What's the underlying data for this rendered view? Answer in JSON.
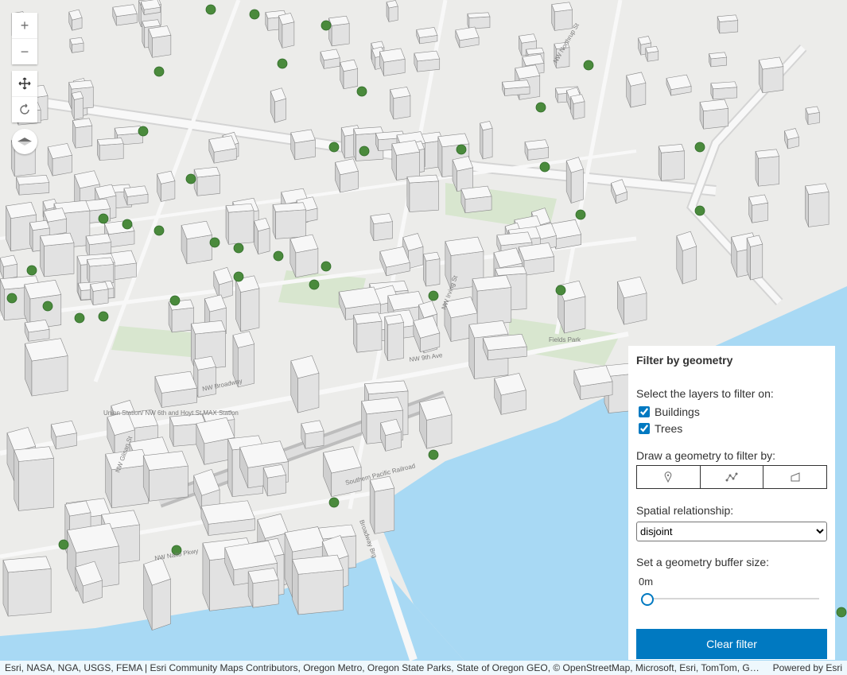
{
  "map": {
    "colors": {
      "water": "#a8d9f4",
      "ground": "#ececea",
      "park": "#d8e6cf",
      "road": "#f8f8f8",
      "building": "#f4f4f4",
      "tree": "#4a8a3c"
    },
    "street_labels": [
      "NW 9th Ave",
      "NW Broadway",
      "Southern Pacific Railroad",
      "Broadway Brg",
      "Fields Park",
      "Union Station/ NW 6th and Hoyt St MAX Station",
      "NW Naito Pkwy",
      "NW Irving St",
      "NW Glisan St",
      "NW Northrup St"
    ]
  },
  "navigation": {
    "zoom_in": "+",
    "zoom_out": "−",
    "pan_icon": "pan-icon",
    "rotate_icon": "rotate-icon",
    "compass_icon": "compass-icon"
  },
  "panel": {
    "title": "Filter by geometry",
    "layers_label": "Select the layers to filter on:",
    "layers": [
      {
        "label": "Buildings",
        "checked": true
      },
      {
        "label": "Trees",
        "checked": true
      }
    ],
    "draw_label": "Draw a geometry to filter by:",
    "draw_tools": [
      "point-icon",
      "polyline-icon",
      "polygon-icon"
    ],
    "relationship_label": "Spatial relationship:",
    "relationship_selected": "disjoint",
    "buffer_label": "Set a geometry buffer size:",
    "buffer_value": "0m",
    "buffer_level": 0,
    "clear_button": "Clear filter",
    "accent_color": "#0079c1"
  },
  "attribution": {
    "text": "Esri, NASA, NGA, USGS, FEMA | Esri Community Maps Contributors, Oregon Metro, Oregon State Parks, State of Oregon GEO, © OpenStreetMap, Microsoft, Esri, TomTom, Garmin, SafeGraph, GeoTechnologies, Inc, METI/NASA, USGS, Bureau of Land Management, EPA, NPS, US Census Bureau, USDA, USFWS",
    "powered_by": "Powered by Esri"
  }
}
